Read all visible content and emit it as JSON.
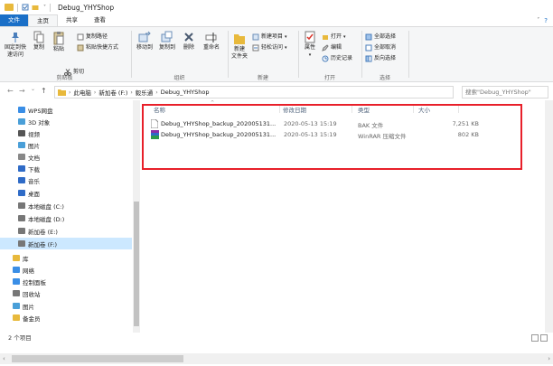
{
  "window": {
    "title": "Debug_YHYShop",
    "help_glyph": "?",
    "chevron_glyph": "˅"
  },
  "tabs": {
    "file": "文件",
    "home": "主页",
    "share": "共享",
    "view": "查看"
  },
  "ribbon": {
    "clipboard": {
      "label": "剪贴板",
      "pin": "固定到快速访问",
      "copy": "复制",
      "paste": "粘贴",
      "cut": "剪切",
      "copy_path": "复制路径",
      "paste_shortcut": "粘贴快捷方式"
    },
    "organize": {
      "label": "组织",
      "move_to": "移动到",
      "copy_to": "复制到",
      "delete": "删除",
      "rename": "重命名"
    },
    "new": {
      "label": "新建",
      "new_folder": "新建\n文件夹",
      "new_item": "新建项目",
      "easy_access": "轻松访问"
    },
    "open": {
      "label": "打开",
      "properties": "属性",
      "open": "打开",
      "edit": "编辑",
      "history": "历史记录"
    },
    "select": {
      "label": "选择",
      "select_all": "全部选择",
      "select_none": "全部取消",
      "invert": "反向选择"
    }
  },
  "address": {
    "back": "←",
    "forward": "→",
    "up_dropdown": "⌄",
    "up": "↑",
    "crumbs": [
      "此电脑",
      "新加卷 (F:)",
      "毅乐通",
      "Debug_YHYShop"
    ],
    "separator": "›",
    "search_placeholder": "搜索\"Debug_YHYShop\""
  },
  "navpane": {
    "items": [
      {
        "label": "WPS网盘",
        "icon": "cloud-icon"
      },
      {
        "label": "3D 对象",
        "icon": "cube-icon"
      },
      {
        "label": "视频",
        "icon": "video-icon"
      },
      {
        "label": "图片",
        "icon": "picture-icon"
      },
      {
        "label": "文档",
        "icon": "document-icon"
      },
      {
        "label": "下载",
        "icon": "download-icon"
      },
      {
        "label": "音乐",
        "icon": "music-icon"
      },
      {
        "label": "桌面",
        "icon": "desktop-icon"
      },
      {
        "label": "本地磁盘 (C:)",
        "icon": "drive-icon"
      },
      {
        "label": "本地磁盘 (D:)",
        "icon": "drive-icon"
      },
      {
        "label": "新加卷 (E:)",
        "icon": "drive-icon"
      },
      {
        "label": "新加卷 (F:)",
        "icon": "drive-icon",
        "selected": true
      },
      {
        "label": "库",
        "icon": "library-icon"
      },
      {
        "label": "网络",
        "icon": "network-icon"
      },
      {
        "label": "控制面板",
        "icon": "control-panel-icon"
      },
      {
        "label": "回收站",
        "icon": "recycle-bin-icon"
      },
      {
        "label": "图片",
        "icon": "picture-icon"
      },
      {
        "label": "备金员",
        "icon": "folder-icon"
      }
    ]
  },
  "columns": {
    "name": "名称",
    "date": "修改日期",
    "type": "类型",
    "size": "大小",
    "sort_glyph": "^"
  },
  "files": [
    {
      "name": "Debug_YHYShop_backup_202005131...",
      "date": "2020-05-13 15:19",
      "type": "BAK 文件",
      "size": "7,251 KB",
      "icon": "bak-file-icon"
    },
    {
      "name": "Debug_YHYShop_backup_202005131...",
      "date": "2020-05-13 15:19",
      "type": "WinRAR 压缩文件",
      "size": "802 KB",
      "icon": "winrar-icon"
    }
  ],
  "status": {
    "count": "2 个项目"
  },
  "scroll": {
    "left_arrow": "‹",
    "right_arrow": "›"
  },
  "colors": {
    "accent": "#1a6fc7",
    "highlight_box": "#e8202a",
    "selection": "#cce8ff"
  }
}
